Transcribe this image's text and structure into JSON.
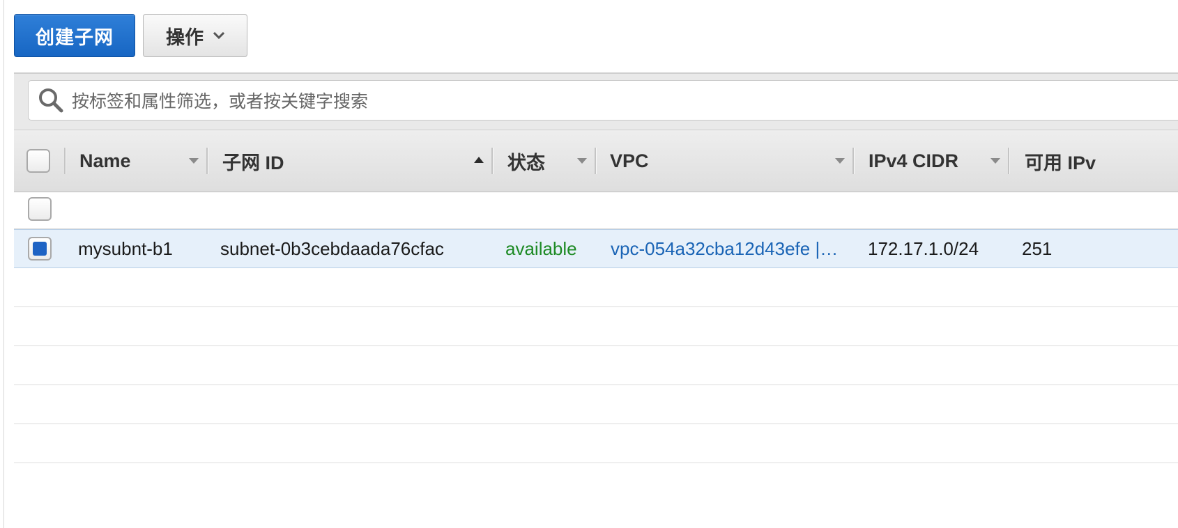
{
  "toolbar": {
    "create_subnet_label": "创建子网",
    "actions_label": "操作"
  },
  "search": {
    "placeholder": "按标签和属性筛选，或者按关键字搜索"
  },
  "table": {
    "columns": [
      "Name",
      "子网 ID",
      "状态",
      "VPC",
      "IPv4 CIDR",
      "可用 IPv"
    ],
    "sorted_column": "子网 ID",
    "sort_direction": "ascending",
    "rows": [
      {
        "name": "mysubnt-b1",
        "subnet_id": "subnet-0b3cebdaada76cfac",
        "state": "available",
        "vpc": "vpc-054a32cba12d43efe |…",
        "ipv4_cidr": "172.17.1.0/24",
        "available_ipv4": "251",
        "selected": true
      }
    ]
  },
  "colors": {
    "primary_button": "#1766c3",
    "status_available": "#1d8a24",
    "link": "#1a64b5",
    "selected_row": "#e6f0fa"
  }
}
